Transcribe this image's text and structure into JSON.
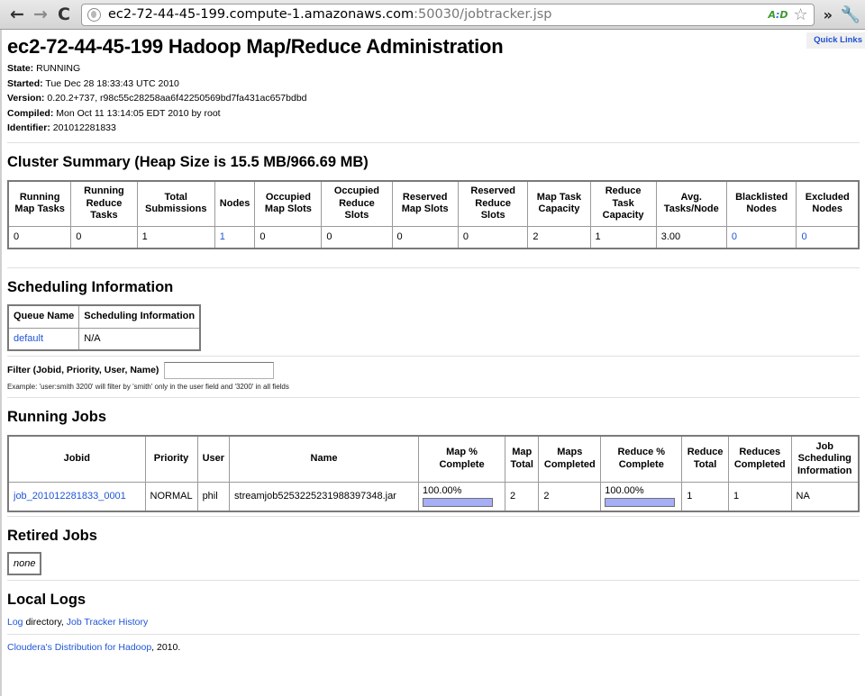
{
  "browser": {
    "url_host": "ec2-72-44-45-199.compute-1.amazonaws.com",
    "url_rest": ":50030/jobtracker.jsp",
    "back_icon": "←",
    "forward_icon": "→",
    "reload_icon": "C",
    "extension_label_a": "A",
    "extension_label_b": "D",
    "star_icon": "☆",
    "overflow_icon": "»",
    "wrench_icon": "🔧"
  },
  "quick_links": "Quick Links",
  "header": {
    "title": "ec2-72-44-45-199 Hadoop Map/Reduce Administration",
    "info": [
      {
        "label": "State:",
        "value": "RUNNING"
      },
      {
        "label": "Started:",
        "value": "Tue Dec 28 18:33:43 UTC 2010"
      },
      {
        "label": "Version:",
        "value": "0.20.2+737, r98c55c28258aa6f42250569bd7fa431ac657bdbd"
      },
      {
        "label": "Compiled:",
        "value": "Mon Oct 11 13:14:05 EDT 2010 by root"
      },
      {
        "label": "Identifier:",
        "value": "201012281833"
      }
    ]
  },
  "cluster_summary": {
    "title": "Cluster Summary (Heap Size is 15.5 MB/966.69 MB)",
    "headers": [
      "Running Map Tasks",
      "Running Reduce Tasks",
      "Total Submissions",
      "Nodes",
      "Occupied Map Slots",
      "Occupied Reduce Slots",
      "Reserved Map Slots",
      "Reserved Reduce Slots",
      "Map Task Capacity",
      "Reduce Task Capacity",
      "Avg. Tasks/Node",
      "Blacklisted Nodes",
      "Excluded Nodes"
    ],
    "values": [
      "0",
      "0",
      "1",
      "1",
      "0",
      "0",
      "0",
      "0",
      "2",
      "1",
      "3.00",
      "0",
      "0"
    ]
  },
  "scheduling": {
    "title": "Scheduling Information",
    "headers": [
      "Queue Name",
      "Scheduling Information"
    ],
    "rows": [
      {
        "queue": "default",
        "info": "N/A"
      }
    ]
  },
  "filter": {
    "label": "Filter (Jobid, Priority, User, Name)",
    "value": "",
    "example": "Example: 'user:smith 3200' will filter by 'smith' only in the user field and '3200' in all fields"
  },
  "running_jobs": {
    "title": "Running Jobs",
    "headers": [
      "Jobid",
      "Priority",
      "User",
      "Name",
      "Map % Complete",
      "Map Total",
      "Maps Completed",
      "Reduce % Complete",
      "Reduce Total",
      "Reduces Completed",
      "Job Scheduling Information"
    ],
    "rows": [
      {
        "jobid": "job_201012281833_0001",
        "priority": "NORMAL",
        "user": "phil",
        "name": "streamjob5253225231988397348.jar",
        "map_pct_text": "100.00%",
        "map_pct": 100,
        "map_total": "2",
        "maps_completed": "2",
        "reduce_pct_text": "100.00%",
        "reduce_pct": 100,
        "reduce_total": "1",
        "reduces_completed": "1",
        "sched_info": "NA"
      }
    ]
  },
  "retired_jobs": {
    "title": "Retired Jobs",
    "empty_text": "none"
  },
  "local_logs": {
    "title": "Local Logs",
    "log_link": "Log",
    "log_suffix": " directory, ",
    "history_link": "Job Tracker History"
  },
  "footer": {
    "link": "Cloudera's Distribution for Hadoop",
    "suffix": ", 2010."
  },
  "colors": {
    "link": "#1f55d6",
    "progress_fill": "#a6aef5"
  }
}
